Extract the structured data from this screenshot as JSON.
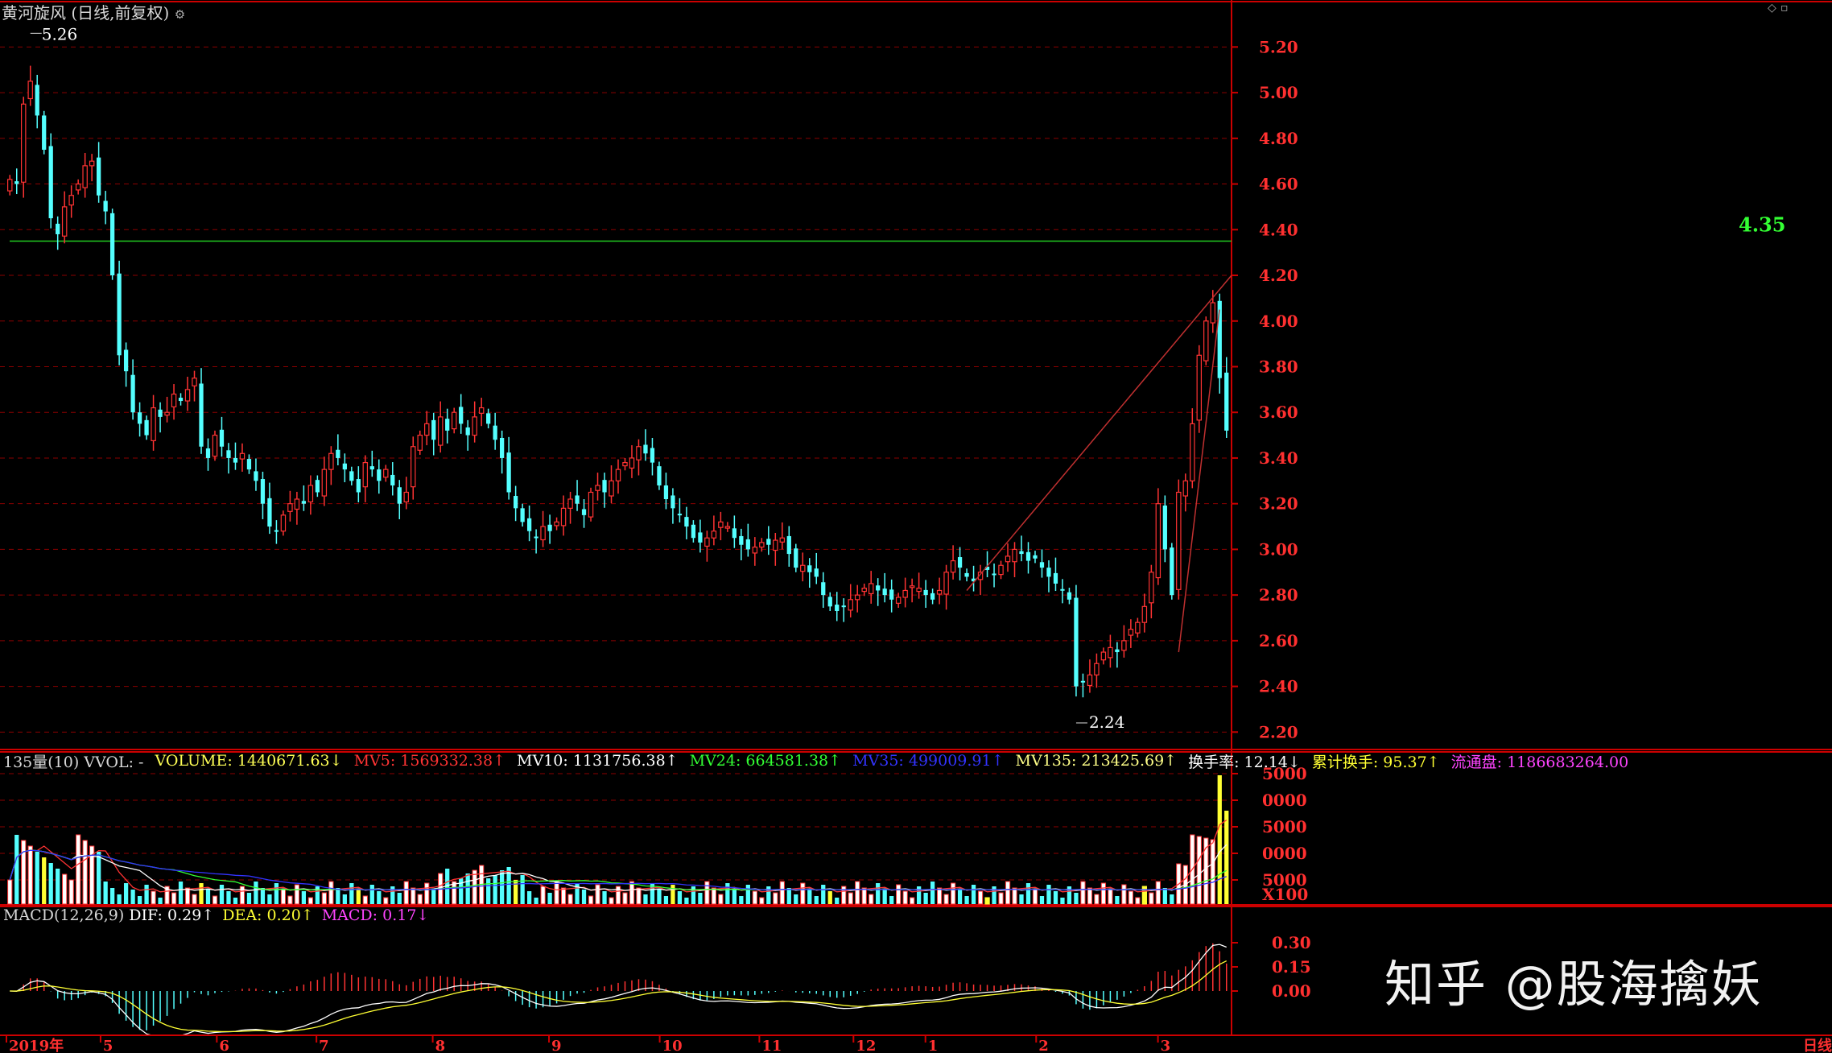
{
  "price_panel": {
    "title": "黄河旋风 (日线,前复权)",
    "title_icon": "gear-icon",
    "y_ticks": [
      "5.20",
      "5.00",
      "4.80",
      "4.60",
      "4.40",
      "4.20",
      "4.00",
      "3.80",
      "3.60",
      "3.40",
      "3.20",
      "3.00",
      "2.80",
      "2.60",
      "2.40",
      "2.20"
    ],
    "high_label": "5.26",
    "low_label": "2.24",
    "hline_label": "4.35",
    "colors": {
      "up": "#ff3333",
      "down": "#54ffff",
      "grid": "#8b0000",
      "axis": "#cc0000",
      "hline": "#22cc22"
    }
  },
  "volume_panel": {
    "name": "135量(10) VVOL: -",
    "volume": "VOLUME: 1440671.63↓",
    "mv5": "MV5: 1569332.38↑",
    "mv10": "MV10: 1131756.38↑",
    "mv24": "MV24: 664581.38↑",
    "mv35": "MV35: 499009.91↑",
    "mv135": "MV135: 213425.69↑",
    "turnover": "换手率: 12.14↓",
    "cum_turnover": "累计换手: 95.37↑",
    "float_shares": "流通盘: 1186683264.00",
    "y_ticks": [
      "5000",
      "0000",
      "5000",
      "0000",
      "5000"
    ],
    "unit": "X100"
  },
  "macd_panel": {
    "name": "MACD(12,26,9)",
    "dif": "DIF: 0.29↑",
    "dea": "DEA: 0.20↑",
    "macd": "MACD: 0.17↓",
    "y_ticks": [
      "0.30",
      "0.15",
      "0.00"
    ]
  },
  "time_axis": {
    "labels": [
      "2019年",
      "5",
      "6",
      "7",
      "8",
      "9",
      "10",
      "11",
      "12",
      "1",
      "2",
      "3"
    ],
    "period": "日线"
  },
  "watermark": "知乎 @股海擒妖",
  "chart_data": {
    "type": "candlestick",
    "bars_from": "2019-04",
    "bars_to": "2020-03",
    "close": [
      4.62,
      4.6,
      4.95,
      5.05,
      4.9,
      4.75,
      4.45,
      4.38,
      4.5,
      4.55,
      4.6,
      4.68,
      4.7,
      4.55,
      4.48,
      4.2,
      3.85,
      3.78,
      3.6,
      3.55,
      3.5,
      3.62,
      3.58,
      3.6,
      3.68,
      3.65,
      3.7,
      3.75,
      3.45,
      3.4,
      3.5,
      3.45,
      3.4,
      3.38,
      3.42,
      3.35,
      3.3,
      3.2,
      3.1,
      3.08,
      3.15,
      3.2,
      3.22,
      3.2,
      3.28,
      3.25,
      3.35,
      3.42,
      3.4,
      3.35,
      3.3,
      3.25,
      3.38,
      3.35,
      3.3,
      3.35,
      3.28,
      3.2,
      3.25,
      3.45,
      3.5,
      3.55,
      3.48,
      3.58,
      3.52,
      3.6,
      3.55,
      3.5,
      3.58,
      3.62,
      3.55,
      3.48,
      3.4,
      3.25,
      3.18,
      3.12,
      3.08,
      3.05,
      3.1,
      3.08,
      3.12,
      3.18,
      3.22,
      3.2,
      3.15,
      3.25,
      3.28,
      3.25,
      3.3,
      3.35,
      3.38,
      3.4,
      3.45,
      3.42,
      3.38,
      3.28,
      3.22,
      3.18,
      3.15,
      3.1,
      3.05,
      3.03,
      3.05,
      3.08,
      3.12,
      3.1,
      3.05,
      3.02,
      3.0,
      3.01,
      3.03,
      3.02,
      3.04,
      3.05,
      2.98,
      2.92,
      2.93,
      2.9,
      2.88,
      2.8,
      2.75,
      2.73,
      2.75,
      2.78,
      2.8,
      2.83,
      2.85,
      2.82,
      2.8,
      2.78,
      2.79,
      2.82,
      2.84,
      2.83,
      2.8,
      2.78,
      2.82,
      2.9,
      2.95,
      2.92,
      2.88,
      2.86,
      2.9,
      2.91,
      2.89,
      2.93,
      2.97,
      3.0,
      2.98,
      2.95,
      2.96,
      2.92,
      2.88,
      2.85,
      2.82,
      2.78,
      2.4,
      2.42,
      2.45,
      2.5,
      2.55,
      2.57,
      2.55,
      2.6,
      2.65,
      2.68,
      2.75,
      2.9,
      3.2,
      3.0,
      2.8,
      3.25,
      3.3,
      3.55,
      3.85,
      4.0,
      4.08,
      3.75,
      3.52
    ],
    "high_price": 5.26,
    "low_price": 2.24,
    "reference_line": 4.35,
    "ylim": [
      2.18,
      5.3
    ]
  }
}
